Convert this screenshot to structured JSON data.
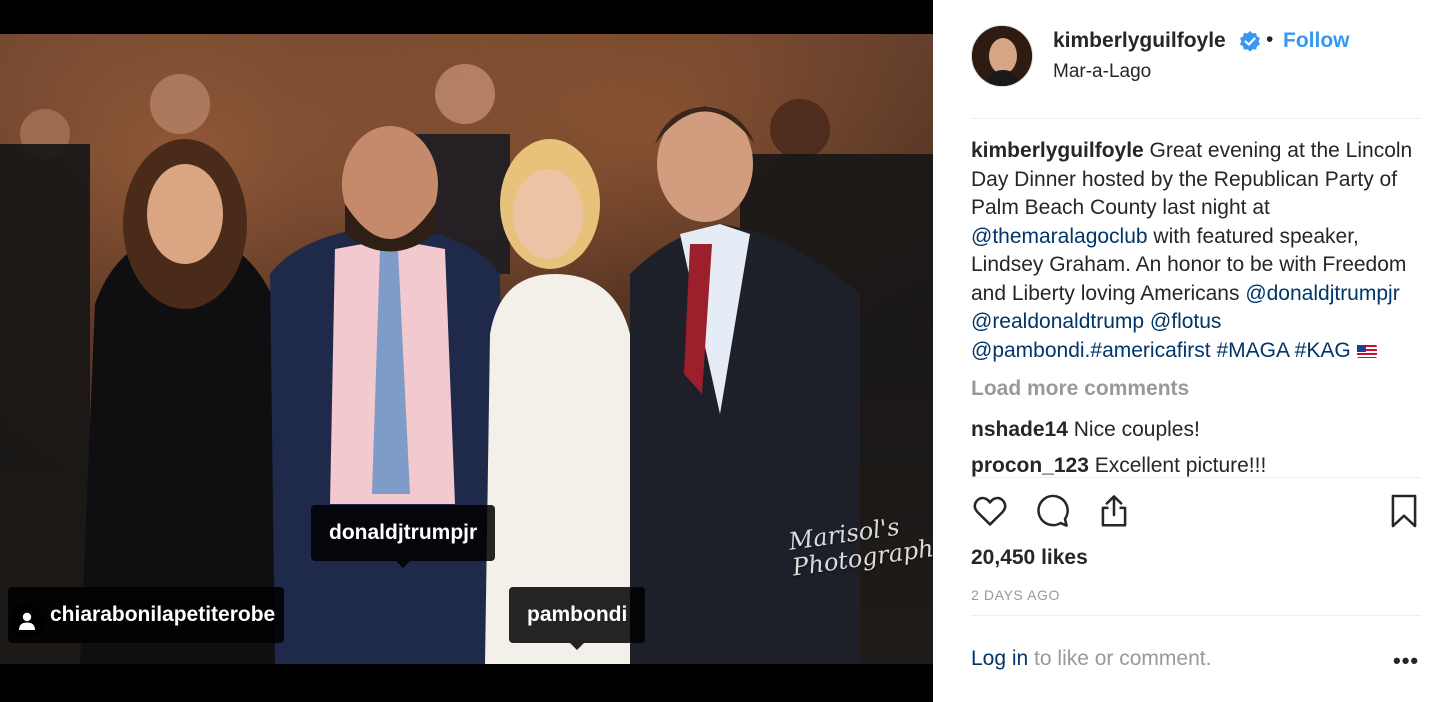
{
  "photo": {
    "watermark": "Marisol's Photography",
    "tags": {
      "donald": "donaldjtrumpjr",
      "pam": "pambondi",
      "chiara": "chiarabonilapetiterobe"
    }
  },
  "header": {
    "avatar_icon": "profile-photo",
    "username": "kimberlyguilfoyle",
    "verified_icon": "verified-badge-icon",
    "separator": "•",
    "follow_label": "Follow",
    "location": "Mar-a-Lago"
  },
  "caption": {
    "username": "kimberlyguilfoyle",
    "text": " Great evening at the Lincoln Day Dinner hosted by the Republican Party of Palm Beach County last night at ",
    "mention_club": "@themaralagoclub",
    "text2": " with featured speaker, Lindsey Graham. An honor to be with Freedom and Liberty loving Americans ",
    "mention_jr": "@donaldjtrumpjr",
    "mention_real": "@realdonaldtrump",
    "mention_flotus": "@flotus",
    "mention_pam": "@pambondi.",
    "hashtag_af": "#americafirst",
    "hashtag_maga": "#MAGA",
    "hashtag_kag": "#KAG"
  },
  "load_more": "Load more comments",
  "comments": [
    {
      "user": "nshade14",
      "text": "Nice couples!"
    },
    {
      "user": "procon_123",
      "text": "Excellent picture!!!"
    }
  ],
  "actions": {
    "like_icon": "heart-icon",
    "comment_icon": "comment-icon",
    "share_icon": "share-icon",
    "save_icon": "bookmark-icon"
  },
  "likes": "20,450 likes",
  "timestamp": "2 DAYS AGO",
  "login": {
    "link": "Log in",
    "rest": " to like or comment."
  },
  "more_label": "•••"
}
